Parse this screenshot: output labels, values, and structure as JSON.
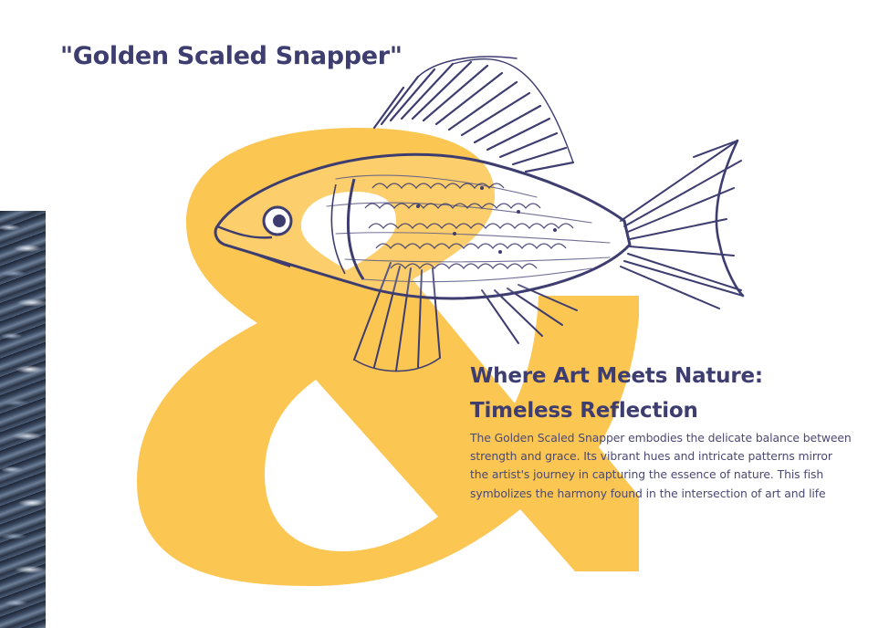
{
  "title": "\"Golden Scaled Snapper\"",
  "heading": {
    "line1": "Where Art Meets Nature:",
    "line2": "Timeless Reflection"
  },
  "body": "The Golden Scaled Snapper embodies the delicate balance between strength and grace. Its vibrant hues and intricate patterns mirror the artist's journey in capturing the essence of nature. This fish symbolizes the harmony found in the intersection of art and life",
  "ampersand_glyph": "&",
  "colors": {
    "accent_yellow": "#fcc653",
    "ink_navy": "#3e3d70",
    "body_text": "#4a4973",
    "background": "#ffffff"
  }
}
